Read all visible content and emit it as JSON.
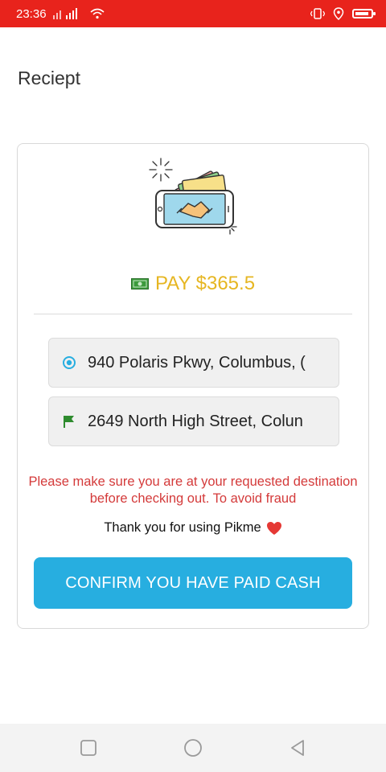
{
  "status_bar": {
    "time": "23:36",
    "background": "#e8231c"
  },
  "page": {
    "title": "Reciept"
  },
  "receipt": {
    "pay_label": "PAY $365.5",
    "pay_color": "#e6b622",
    "pickup_address": "940 Polaris Pkwy, Columbus, (",
    "dropoff_address": "2649 North High Street, Colun",
    "warning_text": "Please make sure you are at your requested destination before checking out. To avoid fraud",
    "thanks_text": "Thank you for using Pikme",
    "confirm_label": "CONFIRM YOU HAVE PAID CASH",
    "confirm_color": "#27aee0"
  },
  "icons": {
    "money": "money-icon",
    "pickup": "location-target-icon",
    "dropoff": "flag-icon",
    "heart": "heart-icon",
    "nav_recents": "square-icon",
    "nav_home": "circle-icon",
    "nav_back": "triangle-back-icon"
  }
}
